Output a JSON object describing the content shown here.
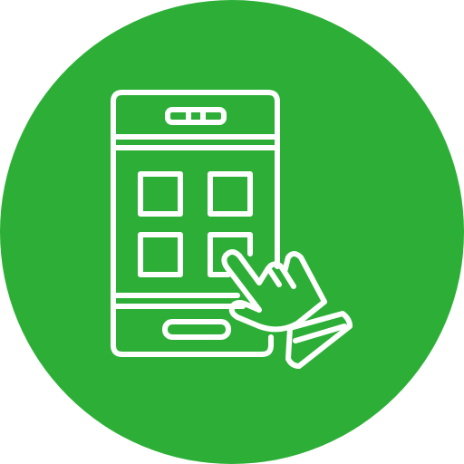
{
  "icon": {
    "name": "mobile-app-touch-icon",
    "background_color": "#2daf37",
    "stroke_color": "#ffffff",
    "parts": [
      "phone-outline",
      "top-speaker-slot",
      "app-grid-2x2",
      "home-button",
      "pointing-hand"
    ]
  }
}
